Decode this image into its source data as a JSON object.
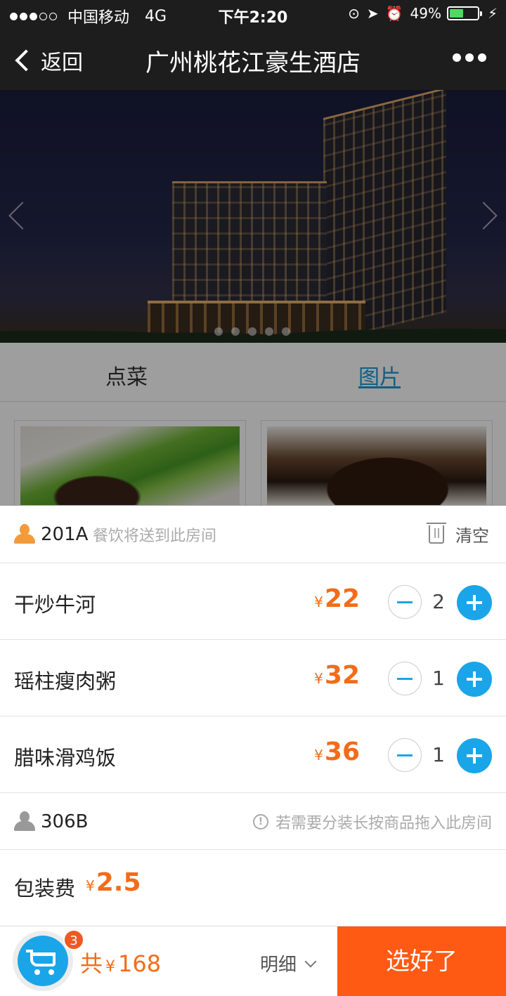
{
  "status_bar": {
    "carrier": "中国移动",
    "network": "4G",
    "time": "下午2:20",
    "battery": "49%",
    "battery_level": 0.49
  },
  "nav": {
    "back_label": "返回",
    "title": "广州桃花江豪生酒店"
  },
  "banner": {
    "page_count": 5
  },
  "tabs": [
    {
      "label": "点菜",
      "active": false
    },
    {
      "label": "图片",
      "active": true
    }
  ],
  "cart": {
    "room": {
      "code": "201A",
      "hint": "餐饮将送到此房间"
    },
    "clear_label": "清空",
    "items": [
      {
        "name": "干炒牛河",
        "currency": "¥",
        "price": "22",
        "qty": "2"
      },
      {
        "name": "瑶柱瘦肉粥",
        "currency": "¥",
        "price": "32",
        "qty": "1"
      },
      {
        "name": "腊味滑鸡饭",
        "currency": "¥",
        "price": "36",
        "qty": "1"
      }
    ],
    "room2": {
      "code": "306B",
      "hint": "若需要分装长按商品拖入此房间"
    },
    "packaging": {
      "label": "包装费",
      "currency": "¥",
      "fee": "2.5"
    }
  },
  "bottom": {
    "badge_count": "3",
    "total_prefix": "共",
    "currency": "¥",
    "total": "168",
    "detail_label": "明细",
    "confirm_label": "选好了"
  },
  "colors": {
    "accent_blue": "#1aa5e8",
    "price_orange": "#f26c1a",
    "confirm_orange": "#ff5a14"
  }
}
